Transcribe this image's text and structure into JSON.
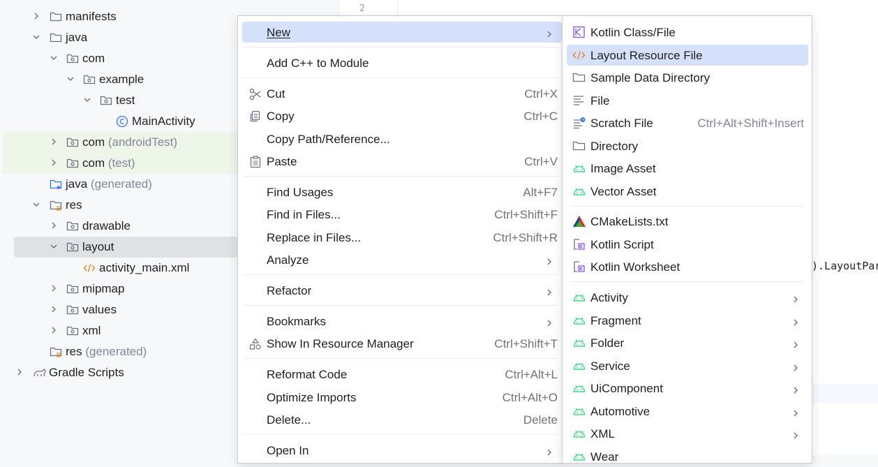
{
  "tree": {
    "rows": [
      {
        "label": "manifests",
        "muted": ""
      },
      {
        "label": "java",
        "muted": ""
      },
      {
        "label": "com",
        "muted": ""
      },
      {
        "label": "example",
        "muted": ""
      },
      {
        "label": "test",
        "muted": ""
      },
      {
        "label": "MainActivity",
        "muted": ""
      },
      {
        "label": "com",
        "muted": "(androidTest)"
      },
      {
        "label": "com",
        "muted": "(test)"
      },
      {
        "label": "java",
        "muted": "(generated)"
      },
      {
        "label": "res",
        "muted": ""
      },
      {
        "label": "drawable",
        "muted": ""
      },
      {
        "label": "layout",
        "muted": ""
      },
      {
        "label": "activity_main.xml",
        "muted": ""
      },
      {
        "label": "mipmap",
        "muted": ""
      },
      {
        "label": "values",
        "muted": ""
      },
      {
        "label": "xml",
        "muted": ""
      },
      {
        "label": "res",
        "muted": "(generated)"
      },
      {
        "label": "Gradle Scripts",
        "muted": ""
      }
    ]
  },
  "editor": {
    "line_number": "2",
    "code_fragment": ").LayoutPara"
  },
  "menu": {
    "items": [
      {
        "label": "New",
        "shortcut": ""
      },
      {
        "label": "Add C++ to Module",
        "shortcut": ""
      },
      {
        "label": "Cut",
        "shortcut": "Ctrl+X"
      },
      {
        "label": "Copy",
        "shortcut": "Ctrl+C"
      },
      {
        "label": "Copy Path/Reference...",
        "shortcut": ""
      },
      {
        "label": "Paste",
        "shortcut": "Ctrl+V"
      },
      {
        "label": "Find Usages",
        "shortcut": "Alt+F7"
      },
      {
        "label": "Find in Files...",
        "shortcut": "Ctrl+Shift+F"
      },
      {
        "label": "Replace in Files...",
        "shortcut": "Ctrl+Shift+R"
      },
      {
        "label": "Analyze",
        "shortcut": ""
      },
      {
        "label": "Refactor",
        "shortcut": ""
      },
      {
        "label": "Bookmarks",
        "shortcut": ""
      },
      {
        "label": "Show In Resource Manager",
        "shortcut": "Ctrl+Shift+T"
      },
      {
        "label": "Reformat Code",
        "shortcut": "Ctrl+Alt+L"
      },
      {
        "label": "Optimize Imports",
        "shortcut": "Ctrl+Alt+O"
      },
      {
        "label": "Delete...",
        "shortcut": "Delete"
      },
      {
        "label": "Open In",
        "shortcut": ""
      }
    ]
  },
  "submenu": {
    "items": [
      {
        "label": "Kotlin Class/File",
        "shortcut": ""
      },
      {
        "label": "Layout Resource File",
        "shortcut": ""
      },
      {
        "label": "Sample Data Directory",
        "shortcut": ""
      },
      {
        "label": "File",
        "shortcut": ""
      },
      {
        "label": "Scratch File",
        "shortcut": "Ctrl+Alt+Shift+Insert"
      },
      {
        "label": "Directory",
        "shortcut": ""
      },
      {
        "label": "Image Asset",
        "shortcut": ""
      },
      {
        "label": "Vector Asset",
        "shortcut": ""
      },
      {
        "label": "CMakeLists.txt",
        "shortcut": ""
      },
      {
        "label": "Kotlin Script",
        "shortcut": ""
      },
      {
        "label": "Kotlin Worksheet",
        "shortcut": ""
      },
      {
        "label": "Activity",
        "shortcut": ""
      },
      {
        "label": "Fragment",
        "shortcut": ""
      },
      {
        "label": "Folder",
        "shortcut": ""
      },
      {
        "label": "Service",
        "shortcut": ""
      },
      {
        "label": "UiComponent",
        "shortcut": ""
      },
      {
        "label": "Automotive",
        "shortcut": ""
      },
      {
        "label": "XML",
        "shortcut": ""
      },
      {
        "label": "Wear",
        "shortcut": ""
      }
    ]
  },
  "colors": {
    "selection": "#d5e1fb",
    "android_green": "#3ddc84",
    "kotlin_purple": "#7f52ff",
    "xml_orange": "#e8802a"
  }
}
